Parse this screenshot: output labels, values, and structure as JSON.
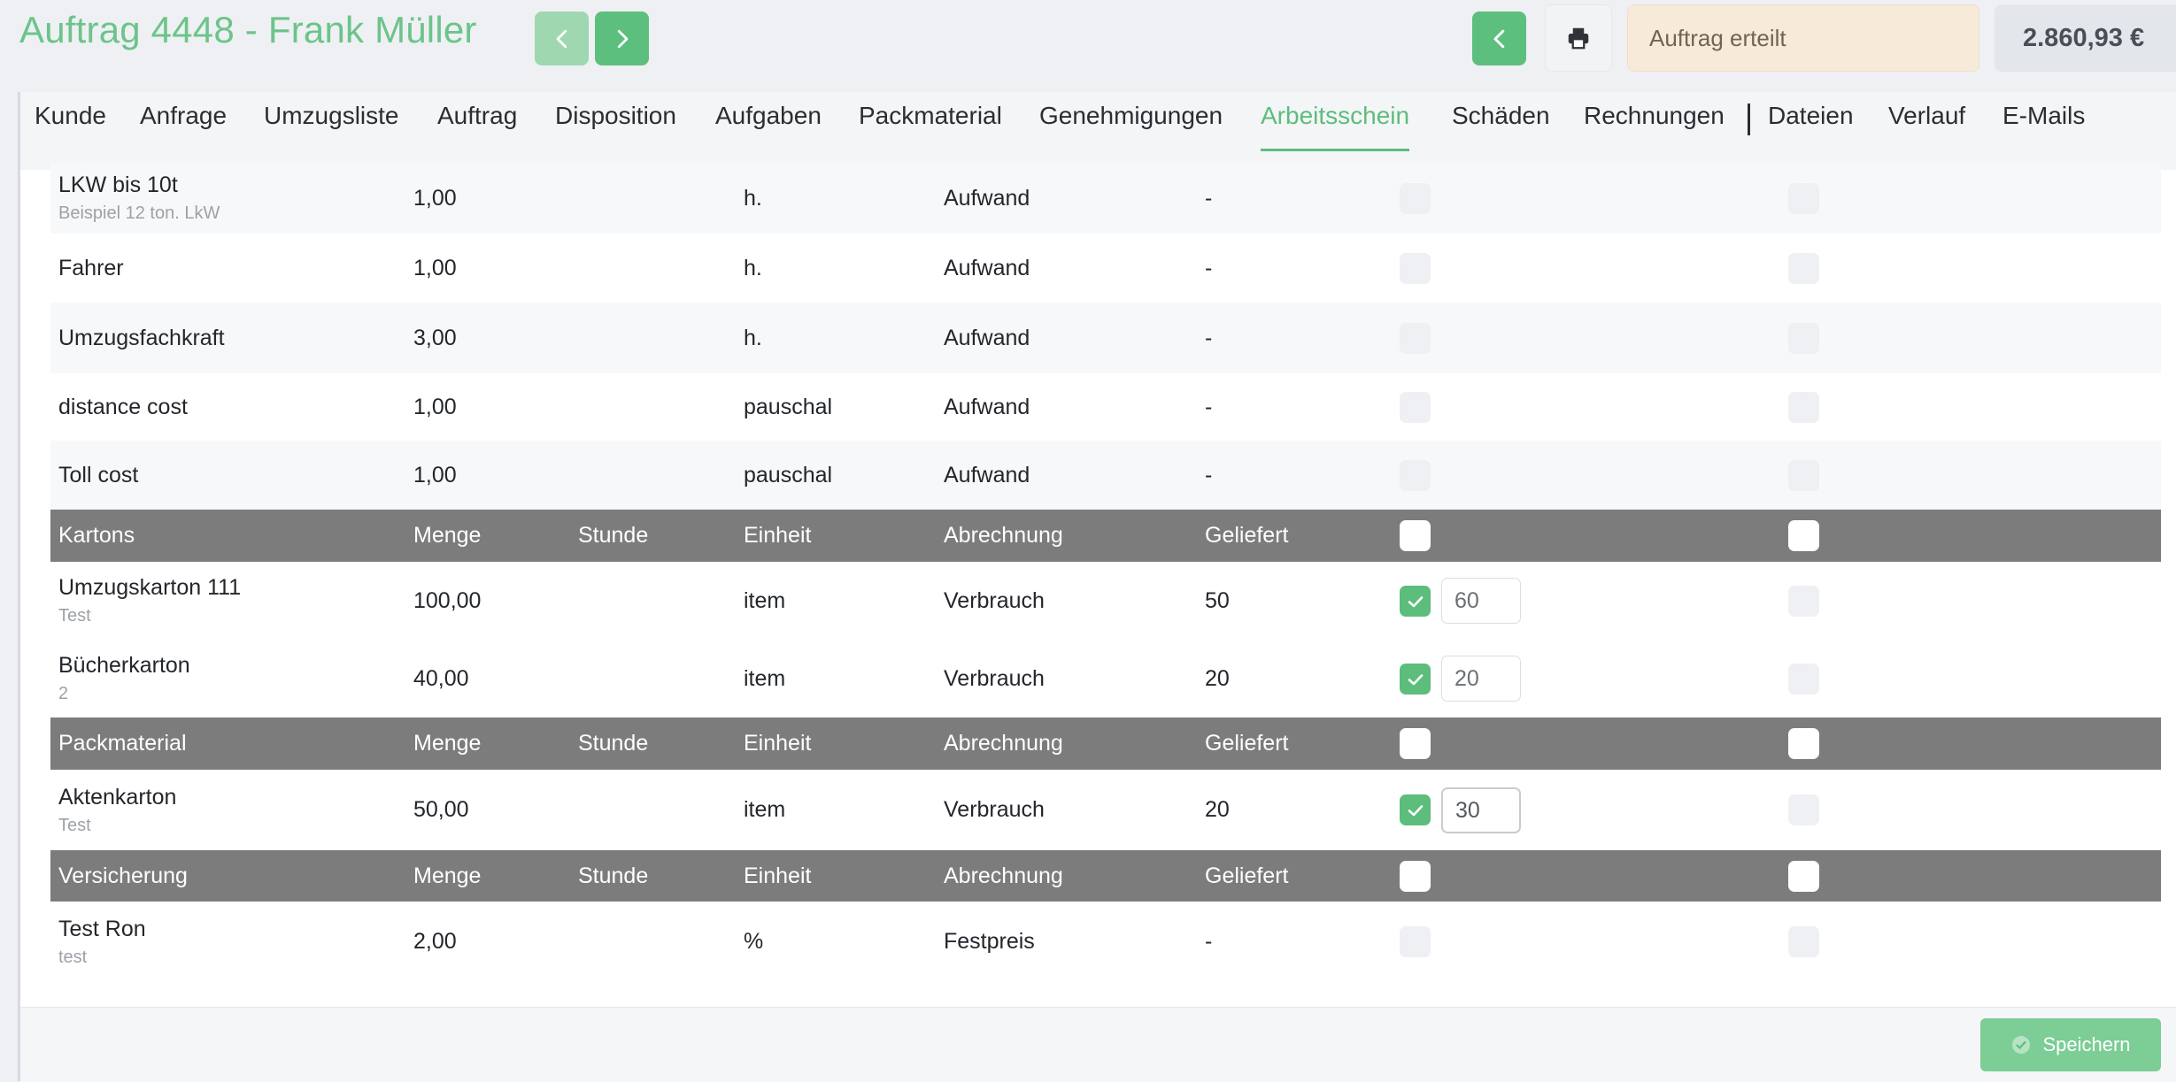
{
  "header": {
    "title": "Auftrag 4448 - Frank Müller",
    "status": "Auftrag erteilt",
    "total": "2.860,93 €"
  },
  "tabs": [
    "Kunde",
    "Anfrage",
    "Umzugsliste",
    "Auftrag",
    "Disposition",
    "Aufgaben",
    "Packmaterial",
    "Genehmigungen",
    "Arbeitsschein",
    "Schäden",
    "Rechnungen",
    "Dateien",
    "Verlauf",
    "E-Mails"
  ],
  "active_tab": "Arbeitsschein",
  "rows": [
    {
      "kind": "item",
      "name": "LKW bis 10t",
      "sub": "Beispiel 12 ton. LkW",
      "menge": "1,00",
      "einheit": "h.",
      "abrechnung": "Aufwand",
      "geliefert": "-"
    },
    {
      "kind": "item",
      "name": "Fahrer",
      "sub": "",
      "menge": "1,00",
      "einheit": "h.",
      "abrechnung": "Aufwand",
      "geliefert": "-"
    },
    {
      "kind": "item",
      "name": "Umzugsfachkraft",
      "sub": "",
      "menge": "3,00",
      "einheit": "h.",
      "abrechnung": "Aufwand",
      "geliefert": "-"
    },
    {
      "kind": "item",
      "name": "distance cost",
      "sub": "",
      "menge": "1,00",
      "einheit": "pauschal",
      "abrechnung": "Aufwand",
      "geliefert": "-"
    },
    {
      "kind": "item",
      "name": "Toll cost",
      "sub": "",
      "menge": "1,00",
      "einheit": "pauschal",
      "abrechnung": "Aufwand",
      "geliefert": "-"
    },
    {
      "kind": "head",
      "name": "Kartons",
      "menge": "Menge",
      "stunde": "Stunde",
      "einheit": "Einheit",
      "abrechnung": "Abrechnung",
      "geliefert": "Geliefert"
    },
    {
      "kind": "item",
      "name": "Umzugskarton 111",
      "sub": "Test",
      "menge": "100,00",
      "einheit": "item",
      "abrechnung": "Verbrauch",
      "geliefert": "50",
      "checked": true,
      "input": "60"
    },
    {
      "kind": "item",
      "name": "Bücherkarton",
      "sub": "2",
      "menge": "40,00",
      "einheit": "item",
      "abrechnung": "Verbrauch",
      "geliefert": "20",
      "checked": true,
      "input": "20"
    },
    {
      "kind": "head",
      "name": "Packmaterial",
      "menge": "Menge",
      "stunde": "Stunde",
      "einheit": "Einheit",
      "abrechnung": "Abrechnung",
      "geliefert": "Geliefert"
    },
    {
      "kind": "item",
      "name": "Aktenkarton",
      "sub": "Test",
      "menge": "50,00",
      "einheit": "item",
      "abrechnung": "Verbrauch",
      "geliefert": "20",
      "checked": true,
      "input": "30",
      "focused": true
    },
    {
      "kind": "head",
      "name": "Versicherung",
      "menge": "Menge",
      "stunde": "Stunde",
      "einheit": "Einheit",
      "abrechnung": "Abrechnung",
      "geliefert": "Geliefert"
    },
    {
      "kind": "item",
      "name": "Test Ron",
      "sub": "test",
      "menge": "2,00",
      "einheit": "%",
      "abrechnung": "Festpreis",
      "geliefert": "-"
    }
  ],
  "footer": {
    "save_label": "Speichern"
  },
  "colors": {
    "accent": "#5cbd7c",
    "group_header": "#7c7c7c",
    "status_bg": "#f7ead9"
  },
  "icons": {
    "prev": "chevron-left-icon",
    "next": "chevron-right-icon",
    "back": "chevron-left-icon",
    "print": "printer-icon",
    "check": "check-icon",
    "save": "check-circle-icon"
  }
}
